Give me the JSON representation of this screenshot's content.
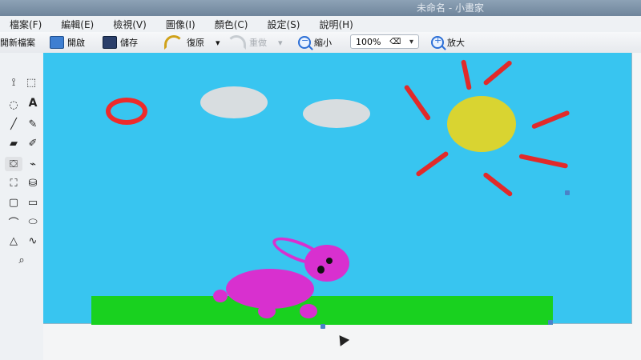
{
  "window": {
    "title": "未命名 - 小畫家"
  },
  "menubar": {
    "items": [
      {
        "label": "檔案(F)"
      },
      {
        "label": "編輯(E)"
      },
      {
        "label": "檢視(V)"
      },
      {
        "label": "圖像(I)"
      },
      {
        "label": "顏色(C)"
      },
      {
        "label": "設定(S)"
      },
      {
        "label": "說明(H)"
      }
    ]
  },
  "toolbar": {
    "new_label": "開新檔案",
    "open_label": "開啟",
    "save_label": "儲存",
    "undo_label": "復原",
    "redo_label": "重做",
    "zoom_out_label": "縮小",
    "zoom_value": "100%",
    "zoom_in_label": "放大"
  },
  "icons": {
    "new": "new-file-icon",
    "open": "open-icon",
    "save": "save-icon",
    "undo": "undo-icon",
    "redo": "redo-icon",
    "zoom_out": "zoom-out-icon",
    "zoom_in": "zoom-in-icon"
  },
  "colors": {
    "sky": "#38c5f0",
    "ground": "#19d11f",
    "sun": "#d9d431",
    "sun_rays": "#e12a2a",
    "rabbit": "#d830cf",
    "cloud": "#d8dde0",
    "ring": "#ee2b2b"
  }
}
